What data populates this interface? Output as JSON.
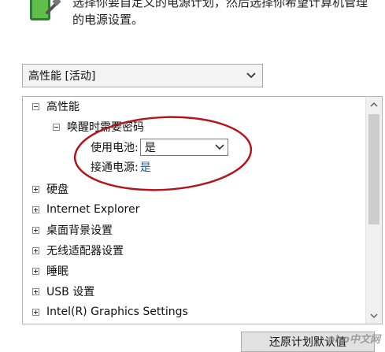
{
  "header": {
    "description_lines": [
      "选择你要自定义的电源计划，然后选择你希望计算机管理",
      "的电源设置。"
    ]
  },
  "plan_dropdown": {
    "selected": "高性能 [活动]"
  },
  "tree": {
    "root": "高性能",
    "group": "唤醒时需要密码",
    "settings": [
      {
        "label": "使用电池:",
        "value": "是"
      },
      {
        "label": "接通电源:",
        "value": "是"
      }
    ],
    "items": [
      "硬盘",
      "Internet Explorer",
      "桌面背景设置",
      "无线适配器设置",
      "睡眠",
      "USB 设置",
      "Intel(R) Graphics Settings"
    ]
  },
  "footer": {
    "restore_label": "还原计划默认值"
  },
  "watermark": "php中文网",
  "icons": {
    "battery": "battery-plug-icon",
    "expand": "plus-icon",
    "collapse": "minus-icon",
    "dropdown": "chevron-down-icon"
  },
  "colors": {
    "link": "#1a5aa6",
    "annotation": "#b3141b"
  }
}
